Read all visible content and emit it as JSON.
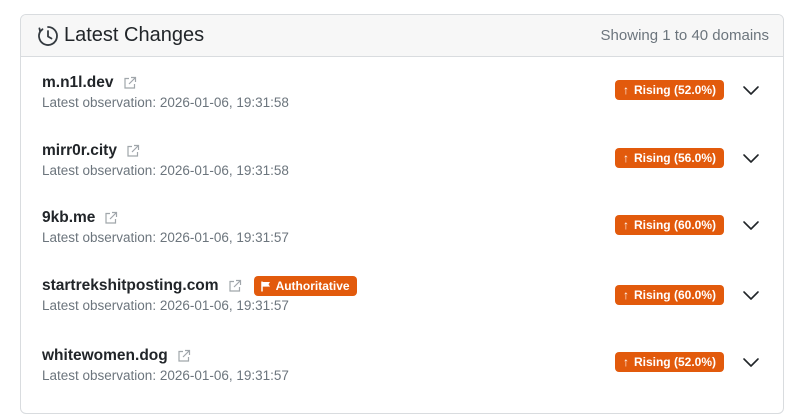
{
  "header": {
    "title": "Latest Changes",
    "count": "Showing 1 to 40 domains"
  },
  "rows": [
    {
      "domain": "m.n1l.dev",
      "observation": "Latest observation: 2026-01-06, 19:31:58",
      "status": "Rising (52.0%)",
      "badge": ""
    },
    {
      "domain": "mirr0r.city",
      "observation": "Latest observation: 2026-01-06, 19:31:58",
      "status": "Rising (56.0%)",
      "badge": ""
    },
    {
      "domain": "9kb.me",
      "observation": "Latest observation: 2026-01-06, 19:31:57",
      "status": "Rising (60.0%)",
      "badge": ""
    },
    {
      "domain": "startrekshitposting.com",
      "observation": "Latest observation: 2026-01-06, 19:31:57",
      "status": "Rising (60.0%)",
      "badge": "Authoritative"
    },
    {
      "domain": "whitewomen.dog",
      "observation": "Latest observation: 2026-01-06, 19:31:57",
      "status": "Rising (52.0%)",
      "badge": ""
    }
  ],
  "colors": {
    "accent": "#e25a0c",
    "muted": "#6c757d"
  },
  "icons": {
    "header": "clock-history-icon",
    "external": "external-link-icon",
    "expand": "chevron-down-icon",
    "flag": "flag-icon"
  }
}
